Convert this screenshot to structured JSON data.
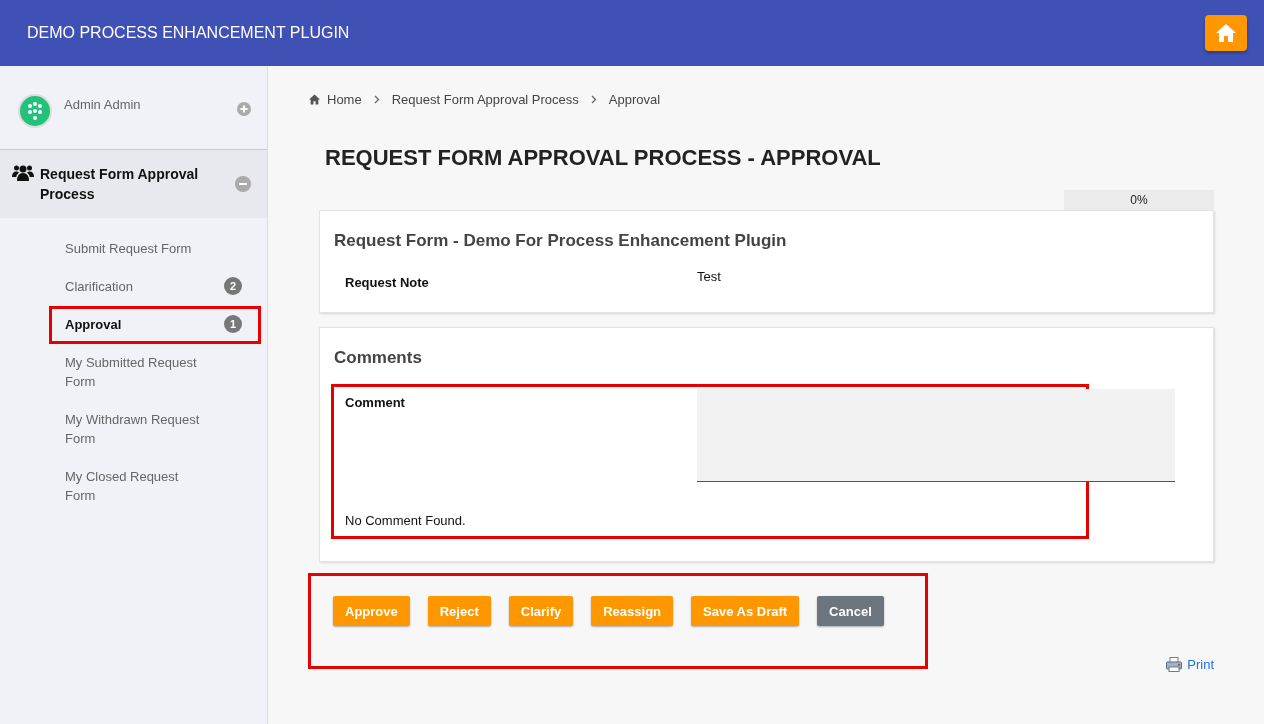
{
  "header": {
    "title": "DEMO PROCESS ENHANCEMENT PLUGIN"
  },
  "sidebar": {
    "user": "Admin Admin",
    "group": {
      "label": "Request Form Approval Process",
      "expanded": true
    },
    "items": [
      {
        "label": "Submit Request Form",
        "selected": false
      },
      {
        "label": "Clarification",
        "badge": "2",
        "selected": false
      },
      {
        "label": "Approval",
        "badge": "1",
        "selected": true
      },
      {
        "label": "My Submitted Request Form",
        "selected": false
      },
      {
        "label": "My Withdrawn Request Form",
        "selected": false
      },
      {
        "label": "My Closed Request Form",
        "selected": false
      }
    ]
  },
  "breadcrumb": [
    "Home",
    "Request Form Approval Process",
    "Approval"
  ],
  "page_title": "REQUEST FORM APPROVAL PROCESS - APPROVAL",
  "progress": {
    "level": 0,
    "reading": "0%"
  },
  "form": {
    "title": "Request Form - Demo For Process Enhancement Plugin",
    "fields": [
      {
        "label": "Request Note",
        "value": "Test"
      }
    ]
  },
  "comments": {
    "title": "Comments",
    "field_label": "Comment",
    "empty_text": "No Comment Found."
  },
  "buttons": [
    {
      "label": "Approve",
      "kind": "primary"
    },
    {
      "label": "Reject",
      "kind": "primary"
    },
    {
      "label": "Clarify",
      "kind": "primary"
    },
    {
      "label": "Reassign",
      "kind": "primary"
    },
    {
      "label": "Save As Draft",
      "kind": "primary"
    },
    {
      "label": "Cancel",
      "kind": "secondary"
    }
  ],
  "print_link": "Print"
}
